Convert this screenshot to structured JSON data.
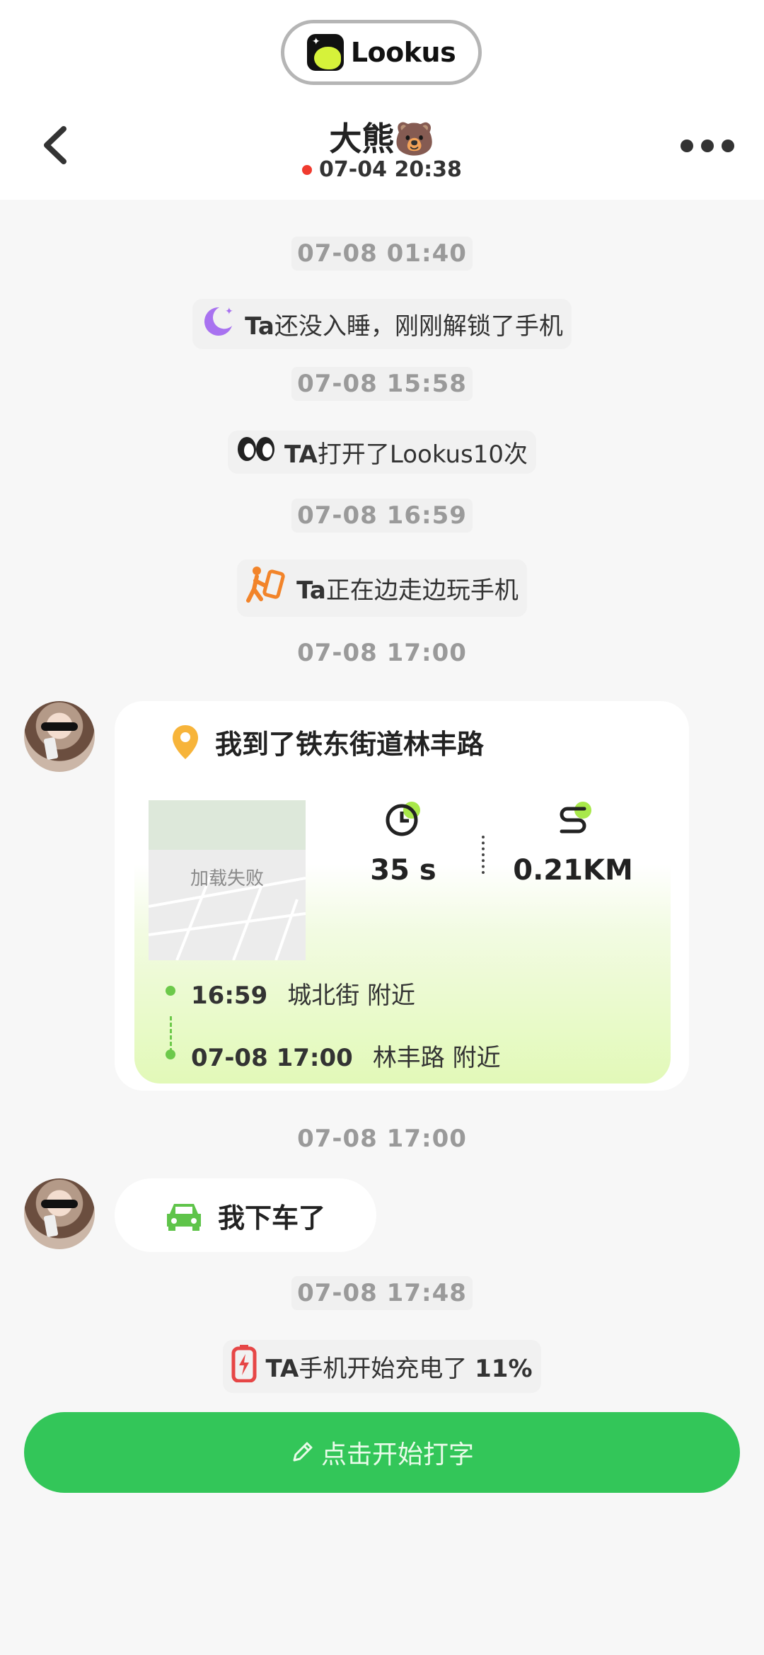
{
  "brand": {
    "name": "Lookus"
  },
  "contact": {
    "name": "大熊🐻",
    "last_seen": "07-04 20:38"
  },
  "feed": {
    "ts1": "07-08 01:40",
    "event1": {
      "prefix": "Ta",
      "text": "还没入睡，刚刚解锁了手机",
      "icon": "moon-icon"
    },
    "ts2": "07-08 15:58",
    "event2": {
      "prefix": "TA",
      "text": "打开了Lookus10次",
      "icon": "eyes-icon"
    },
    "ts3": "07-08 16:59",
    "event3": {
      "prefix": "Ta",
      "text": "正在边走边玩手机",
      "icon": "walking-phone-icon"
    },
    "ts4": "07-08 17:00",
    "location_card": {
      "title": "我到了铁东街道林丰路",
      "map_fail": "加载失败",
      "duration": "35 s",
      "distance": "0.21KM",
      "start_time": "16:59",
      "start_place": "城北街 附近",
      "end_time": "07-08 17:00",
      "end_place": "林丰路 附近"
    },
    "ts5": "07-08 17:00",
    "car_message": "我下车了",
    "ts6": "07-08 17:48",
    "event4": {
      "prefix": "TA",
      "text": "手机开始充电了 ",
      "level": "11%",
      "icon": "battery-charging-icon"
    }
  },
  "composer": {
    "label": "点击开始打字"
  },
  "colors": {
    "accent_green": "#33c659",
    "route_green": "#6cc94a",
    "status_red": "#f03a2e"
  }
}
